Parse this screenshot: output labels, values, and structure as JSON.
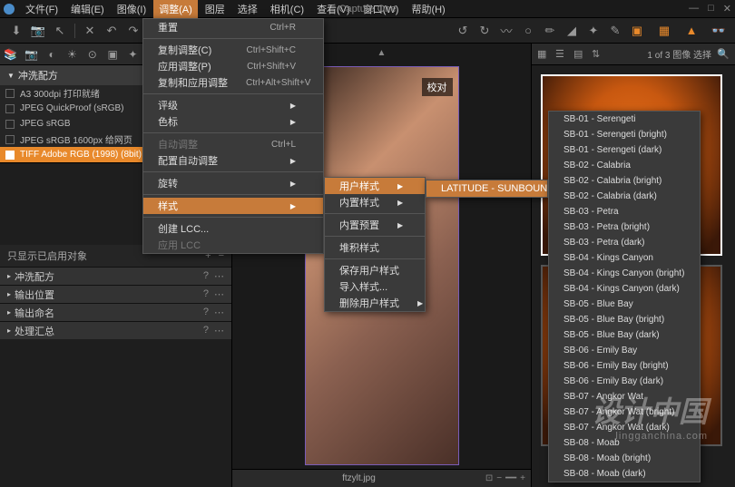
{
  "app_title": "Capture One",
  "menubar": {
    "file": "文件(F)",
    "edit": "编辑(E)",
    "image": "图像(I)",
    "adjust": "调整(A)",
    "layer": "图层",
    "select": "选择",
    "camera": "相机(C)",
    "view": "查看(V)",
    "window": "窗口(W)",
    "help": "帮助(H)"
  },
  "adjust_menu": {
    "reset": "重置",
    "copy_adj": "复制调整(C)",
    "copy_adj_key": "Ctrl+Shift+C",
    "apply_adj": "应用调整(P)",
    "apply_adj_key": "Ctrl+Shift+V",
    "copy_apply": "复制和应用调整",
    "copy_apply_key": "Ctrl+Alt+Shift+V",
    "rating": "评级",
    "color_label": "色标",
    "auto_adj": "自动调整",
    "auto_adj_key": "Ctrl+L",
    "config_auto": "配置自动调整",
    "rotate": "旋转",
    "styles": "样式",
    "create_lcc": "创建 LCC...",
    "apply_lcc": "应用 LCC",
    "reset_key": "Ctrl+R"
  },
  "styles_submenu": {
    "user_styles": "用户样式",
    "builtin_styles": "内置样式",
    "builtin_presets": "内置预置",
    "stack_styles": "堆积样式",
    "save_user_style": "保存用户样式",
    "import_style": "导入样式...",
    "delete_user_style": "删除用户样式"
  },
  "user_style_item": "LATITUDE - SUNBOUND",
  "style_presets": [
    "SB-01 - Serengeti",
    "SB-01 - Serengeti (bright)",
    "SB-01 - Serengeti (dark)",
    "SB-02 - Calabria",
    "SB-02 - Calabria (bright)",
    "SB-02 - Calabria (dark)",
    "SB-03 - Petra",
    "SB-03 - Petra (bright)",
    "SB-03 - Petra (dark)",
    "SB-04 - Kings Canyon",
    "SB-04 - Kings Canyon (bright)",
    "SB-04 - Kings Canyon (dark)",
    "SB-05 - Blue Bay",
    "SB-05 - Blue Bay (bright)",
    "SB-05 - Blue Bay (dark)",
    "SB-06 - Emily Bay",
    "SB-06 - Emily Bay (bright)",
    "SB-06 - Emily Bay (dark)",
    "SB-07 - Angkor Wat",
    "SB-07 - Angkor Wat (bright)",
    "SB-07 - Angkor Wat (dark)",
    "SB-08 - Moab",
    "SB-08 - Moab (bright)",
    "SB-08 - Moab (dark)"
  ],
  "left": {
    "recipe_header": "冲洗配方",
    "presets": [
      "A3 300dpi 打印就绪",
      "JPEG QuickProof (sRGB)",
      "JPEG sRGB",
      "JPEG sRGB 1600px 给网页",
      "TIFF Adobe RGB (1998) (8bit)"
    ],
    "filter_label": "只显示已启用对象",
    "sections": [
      "冲洗配方",
      "输出位置",
      "输出命名",
      "处理汇总"
    ]
  },
  "viewer": {
    "badge": "校对",
    "filename": "ftzylt.jpg"
  },
  "browser": {
    "counter": "1 of 3 图像 选择"
  },
  "watermark": {
    "main": "设计中国",
    "sub": "lingganchina.com"
  }
}
